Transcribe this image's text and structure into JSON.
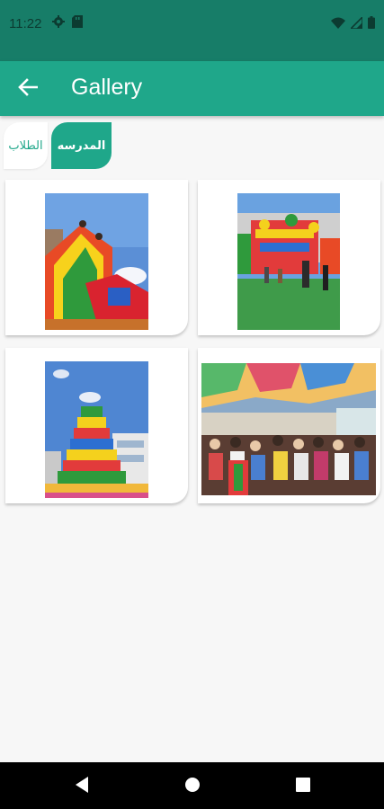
{
  "status_bar": {
    "time": "11:22",
    "left_icons": [
      "settings-icon",
      "sd-card-icon"
    ],
    "right_icons": [
      "wifi-icon",
      "signal-icon",
      "battery-icon"
    ]
  },
  "app_bar": {
    "title": "Gallery",
    "back_icon": "arrow-back-icon"
  },
  "tabs": [
    {
      "label": "الطلاب",
      "active": false
    },
    {
      "label": "المدرسه",
      "active": true
    }
  ],
  "gallery": {
    "items": [
      {
        "subject": "inflatable-slide"
      },
      {
        "subject": "bouncy-castle-playground"
      },
      {
        "subject": "inflatable-tower"
      },
      {
        "subject": "crowd-under-colorful-canopy"
      }
    ]
  },
  "nav_bar": {
    "buttons": [
      "back-triangle-icon",
      "home-circle-icon",
      "recents-square-icon"
    ]
  },
  "colors": {
    "status_bar": "#177d68",
    "app_bar": "#1fa78a",
    "accent": "#1fa78a",
    "background": "#f7f7f7"
  }
}
